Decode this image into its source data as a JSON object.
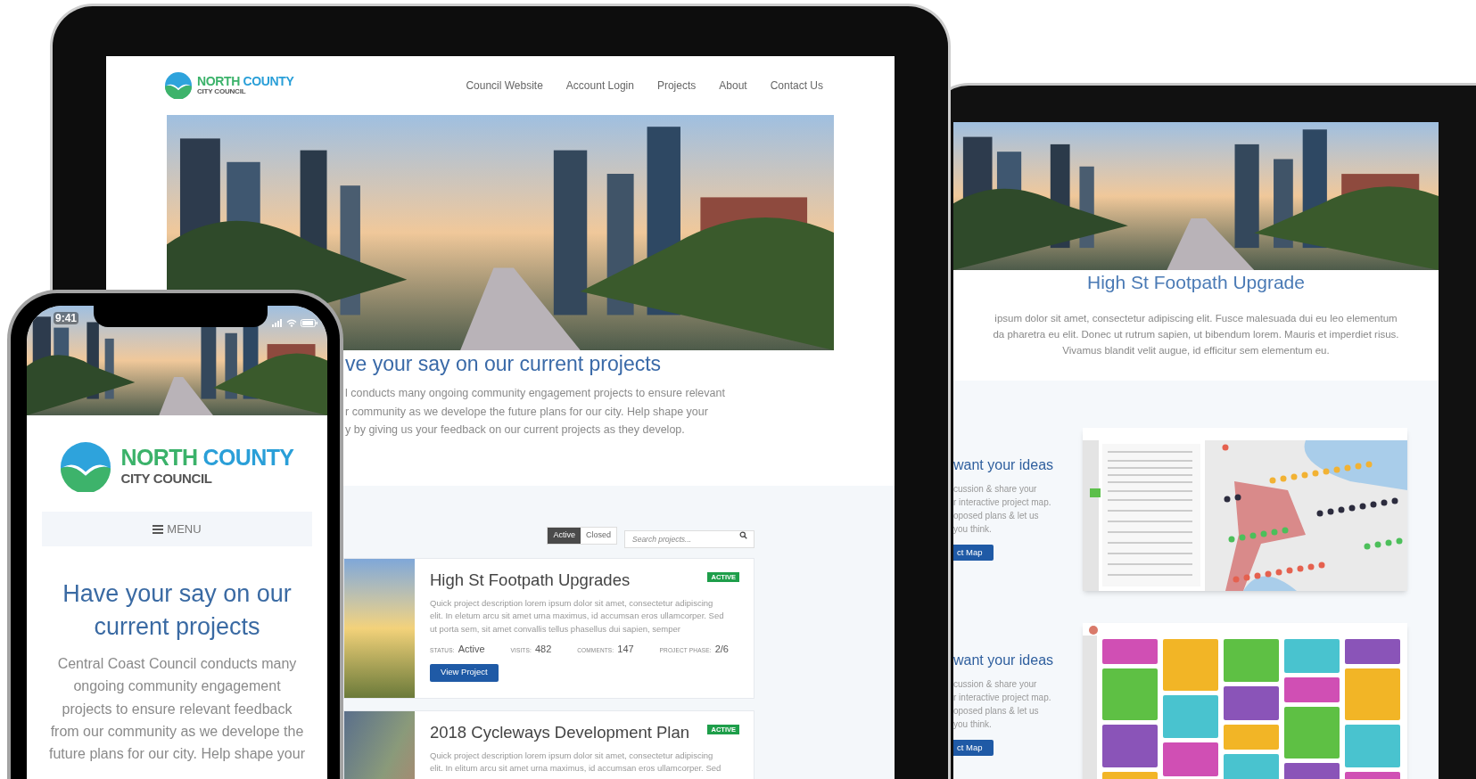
{
  "tablet_main": {
    "logo": {
      "title_1": "NORTH",
      "title_2": "COUNTY",
      "subtitle": "CITY COUNCIL"
    },
    "nav": [
      "Council Website",
      "Account Login",
      "Projects",
      "About",
      "Contact Us"
    ],
    "heading": "ve your say on our current projects",
    "intro_lines": [
      "l conducts many ongoing community engagement projects to ensure relevant",
      "r community as we develope the future plans for our city. Help shape your",
      "y by giving us your feedback on our current projects as they develop."
    ],
    "filters": [
      {
        "label": "Active",
        "selected": true
      },
      {
        "label": "Closed",
        "selected": false
      }
    ],
    "search": {
      "placeholder": "Search projects..."
    },
    "projects": [
      {
        "title": "High St Footpath Upgrades",
        "badge": "ACTIVE",
        "description_lines": [
          "Quick project description lorem ipsum dolor sit amet, consectetur adipiscing",
          "elit. In eletum arcu sit amet urna maximus, id accumsan eros ullamcorper. Sed",
          "ut porta sem, sit amet convallis tellus phasellus dui sapien, semper"
        ],
        "stats": [
          {
            "label": "STATUS:",
            "value": "Active"
          },
          {
            "label": "VISITS:",
            "value": "482"
          },
          {
            "label": "COMMENTS:",
            "value": "147"
          },
          {
            "label": "PROJECT PHASE:",
            "value": "2/6"
          }
        ],
        "button": "View Project"
      },
      {
        "title": "2018 Cycleways Development Plan",
        "badge": "ACTIVE",
        "description_lines": [
          "Quick project description lorem ipsum dolor sit amet, consectetur adipiscing",
          "elit. In elitum arcu sit amet urna maximus, id accumsan eros ullamcorper. Sed"
        ]
      }
    ]
  },
  "tablet_detail": {
    "heading": "High St Footpath Upgrade",
    "intro_lines": [
      "ipsum dolor sit amet, consectetur adipiscing elit. Fusce malesuada dui eu leo elementum",
      "da pharetra eu elit. Donec ut rutrum sapien, ut bibendum lorem. Mauris et imperdiet risus.",
      "Vivamus blandit velit augue, id efficitur sem elementum eu."
    ],
    "sections": [
      {
        "kind": "map",
        "heading": "want your ideas",
        "lines": [
          "cussion & share your",
          "r interactive project map.",
          "oposed plans & let us",
          "you think."
        ],
        "button": "ct Map"
      },
      {
        "kind": "board",
        "heading": "want your ideas",
        "lines": [
          "cussion & share your",
          "r interactive project map.",
          "oposed plans & let us",
          "you think."
        ],
        "button": "ct Map"
      }
    ]
  },
  "phone": {
    "time": "9:41",
    "logo": {
      "title_1": "NORTH",
      "title_2": "COUNTY",
      "subtitle": "CITY COUNCIL"
    },
    "menu": "MENU",
    "heading": "Have your say on our current projects",
    "intro_lines": [
      "Central Coast Council conducts many",
      "ongoing community engagement",
      "projects to ensure relevant feedback",
      "from our community as we develope the",
      "future plans for our city. Help shape your"
    ]
  }
}
